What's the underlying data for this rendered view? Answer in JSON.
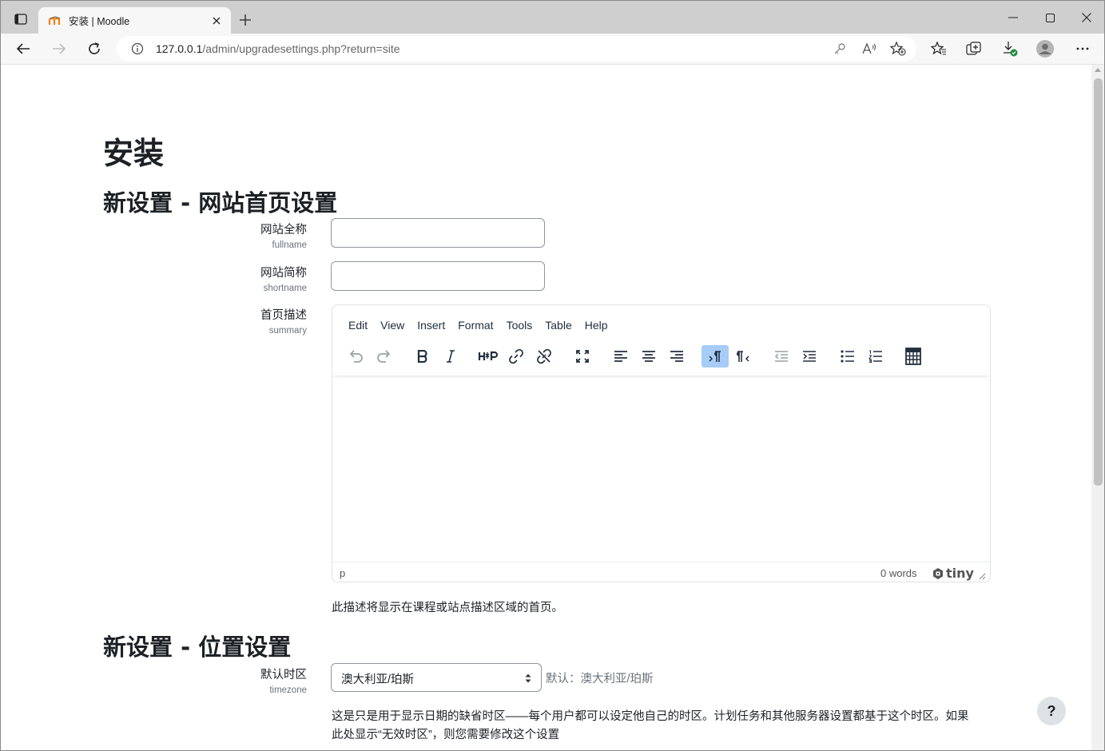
{
  "browser": {
    "tab_title": "安装 | Moodle",
    "url_host": "127.0.0.1",
    "url_path": "/admin/upgradesettings.php?return=site"
  },
  "page": {
    "title": "安装",
    "section1_heading": "新设置 - 网站首页设置",
    "fullname_label": "网站全称",
    "fullname_key": "fullname",
    "fullname_value": "",
    "shortname_label": "网站简称",
    "shortname_key": "shortname",
    "shortname_value": "",
    "summary_label": "首页描述",
    "summary_key": "summary",
    "summary_help": "此描述将显示在课程或站点描述区域的首页。",
    "section2_heading": "新设置 - 位置设置",
    "timezone_label": "默认时区",
    "timezone_key": "timezone",
    "timezone_value": "澳大利亚/珀斯",
    "timezone_default": "默认：澳大利亚/珀斯",
    "timezone_help_line1": "这是只是用于显示日期的缺省时区——每个用户都可以设定他自己的时区。计划任务和其他服务器设置都基于这个时区。如果",
    "timezone_help_line2": "此处显示“无效时区”，则您需要修改这个设置",
    "help_button": "?"
  },
  "editor": {
    "menus": [
      "Edit",
      "View",
      "Insert",
      "Format",
      "Tools",
      "Table",
      "Help"
    ],
    "path": "p",
    "word_count": "0 words",
    "brand": "tiny"
  },
  "colors": {
    "accent": "#a6ccf7",
    "text": "#1d2125",
    "muted": "#6a737b"
  }
}
